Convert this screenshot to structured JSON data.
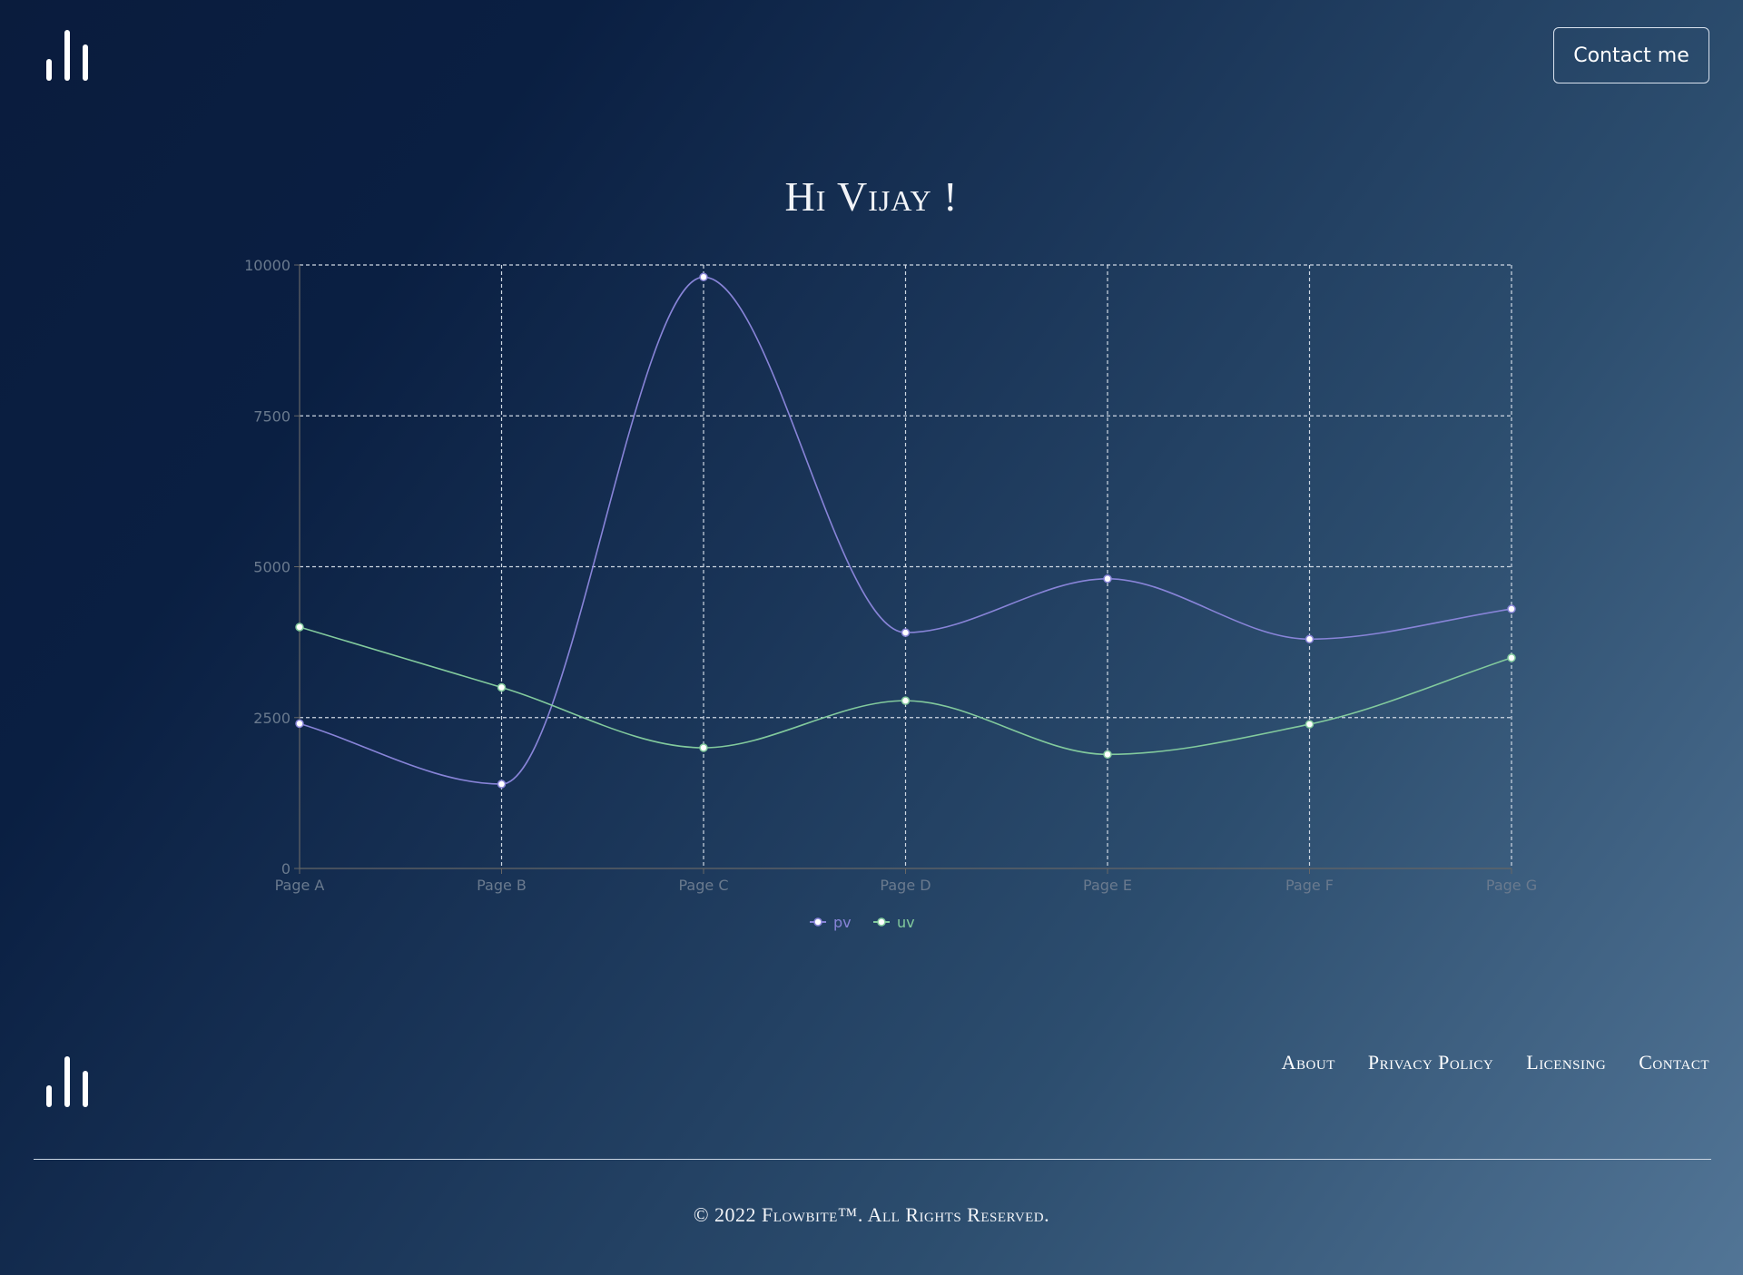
{
  "header": {
    "contact_label": "Contact me"
  },
  "greeting": "Hi Vijay !",
  "footer": {
    "links": [
      "About",
      "Privacy Policy",
      "Licensing",
      "Contact"
    ],
    "copyright": "© 2022 Flowbite™. All Rights Reserved."
  },
  "colors": {
    "pv": "#8884d8",
    "uv": "#82ca9d",
    "grid": "#cfd8e3",
    "axis": "#666666"
  },
  "chart_data": {
    "type": "line",
    "categories": [
      "Page A",
      "Page B",
      "Page C",
      "Page D",
      "Page E",
      "Page F",
      "Page G"
    ],
    "ylim": [
      0,
      10000
    ],
    "yticks": [
      0,
      2500,
      5000,
      7500,
      10000
    ],
    "grid": true,
    "legend_position": "bottom-center",
    "series": [
      {
        "name": "pv",
        "values": [
          2400,
          1398,
          9800,
          3908,
          4800,
          3800,
          4300
        ]
      },
      {
        "name": "uv",
        "values": [
          4000,
          3000,
          2000,
          2780,
          1890,
          2390,
          3490
        ]
      }
    ]
  }
}
